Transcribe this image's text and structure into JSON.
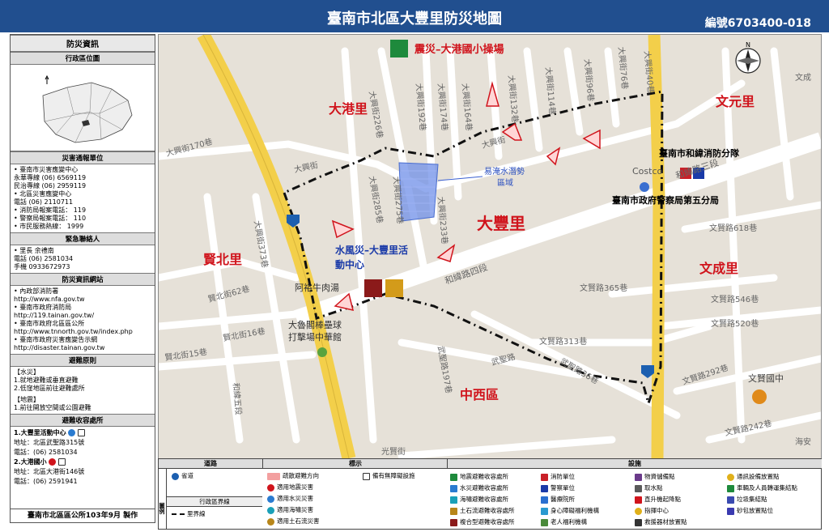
{
  "header": {
    "title": "臺南市北區大豐里防災地圖",
    "code": "編號6703400-018"
  },
  "sidebar": {
    "title": "防災資訊",
    "admin_map": "行政區位圖",
    "report_title": "災害通報單位",
    "report_lines": [
      "• 臺南市災害應變中心",
      "永華專線 (06) 6569119",
      "民治專線 (06) 2959119",
      "• 北區災害應變中心",
      "電話 (06) 2110711",
      "• 消防局報案電話： 119",
      "• 警察局報案電話： 110",
      "• 市民服務熱線： 1999"
    ],
    "contact_title": "緊急聯絡人",
    "contact_lines": [
      "• 里長 余禮南",
      "電話 (06) 2581034",
      "手機 0933672973"
    ],
    "web_title": "防災資訊網站",
    "web_lines": [
      "• 內政部消防署",
      "http://www.nfa.gov.tw",
      "• 臺南市政府消防局",
      "http://119.tainan.gov.tw/",
      "• 臺南市政府北區區公所",
      "http://www.tnnorth.gov.tw/index.php",
      "• 臺南市政府災害應變告示網",
      "http://disaster.tainan.gov.tw"
    ],
    "principle_title": "避難原則",
    "principle_lines": [
      "【水災】",
      "1.就地避難或垂直避難",
      "2.低窪地區前往避難處所",
      "",
      "【地震】",
      "1.前往開放空間或公園避難"
    ],
    "shelter_title": "避難收容處所",
    "shelter_lines": [
      "1.大豐里活動中心",
      "地址：北區武聖路315號",
      "電話：(06) 2581034",
      "2.大港國小",
      "地址：北區大港街146號",
      "電話：(06) 2591941"
    ],
    "footer": "臺南市北區區公所103年9月 製作"
  },
  "map": {
    "districts": [
      "大港里",
      "文元里",
      "大豐里",
      "賢北里",
      "文成里",
      "中西區"
    ],
    "poi": {
      "earthquake_shelter": "震災–大港國小操場",
      "flood_shelter_1": "水風災–大豐里活",
      "flood_shelter_2": "動中心",
      "flood_area_1": "易淹水潛勢",
      "flood_area_2": "區域",
      "fire_brigade": "臺南市和緯消防分隊",
      "police": "臺南市政府警察局第五分局",
      "costco": "Costco",
      "restaurant": "阿裕牛肉湯",
      "batting_1": "大魯閣棒壘球",
      "batting_2": "打擊場中華館"
    },
    "roads": [
      "和緯路四段",
      "和緯路三段",
      "大興街",
      "大興街170巷",
      "大興街226巷",
      "大興街192巷",
      "大興街174巷",
      "大興街164巷",
      "大興街132巷",
      "大興街114巷",
      "大興街96巷",
      "大興街76巷",
      "大興街40巷",
      "大興街285巷",
      "大興街275巷",
      "大興街233巷",
      "大興街373巷",
      "賢北街62巷",
      "賢北街16巷",
      "賢北街15巷",
      "文賢路365巷",
      "文賢路313巷",
      "文賢路618巷",
      "文賢路546巷",
      "文賢路520巷",
      "文賢路292巷",
      "文賢路242巷",
      "武聖路",
      "武聖路36巷",
      "武聖路197巷",
      "光賢街",
      "和緯五段",
      "文賢國中",
      "海安",
      "文成",
      "文賢三段"
    ],
    "road_labels": {
      "r1": "和緯路四段",
      "r2": "大興街170巷",
      "r3": "大興街226巷",
      "r4": "大興街192巷",
      "r5": "大興街174巷",
      "r6": "大興街164巷",
      "r7": "大興街132巷",
      "r8": "大興街114巷",
      "r9": "大興街96巷",
      "r10": "大興街76巷",
      "r11": "大興街40巷",
      "r12": "大興街285巷",
      "r13": "大興街275巷",
      "r14": "大興街233巷",
      "r15": "大興街373巷",
      "r16": "賢北街62巷",
      "r17": "賢北街16巷",
      "r18": "文賢路365巷",
      "r19": "文賢路313巷",
      "r20": "文賢路618巷",
      "r21": "文賢路546巷",
      "r22": "文賢路520巷",
      "r23": "文賢路292巷",
      "r24": "武聖路",
      "r25": "武聖路36巷",
      "r26": "武聖路197巷",
      "r27": "光賢街",
      "r28": "文賢國中",
      "r29": "海安",
      "r30": "文成",
      "r31": "和緯路三段",
      "r32": "文賢路242巷",
      "r33": "和緯五段",
      "r34": "大興街",
      "r35": "賢北街15巷",
      "r36": "大興街"
    }
  },
  "legend": {
    "road_h": "道路",
    "sign_h": "標示",
    "fac_h": "設施",
    "legend_side": "圖例",
    "road_items": [
      "省道",
      "行政區界線",
      "里界線"
    ],
    "sign_items": [
      "疏散避難方向",
      "適用地震災害",
      "適用水災災害",
      "適用海嘯災害",
      "適用土石流災害",
      "備有無障礙設施"
    ],
    "fac_col1": [
      "地震避難收容處所",
      "水災避難收容處所",
      "海嘯避難收容處所",
      "土石流避難收容處所",
      "複合型避難收容處所"
    ],
    "fac_col2": [
      "消防單位",
      "警察單位",
      "醫療院所",
      "身心障礙福利機構",
      "老人福利機構"
    ],
    "fac_col3": [
      "物資儲備點",
      "取水點",
      "直升機起降點",
      "指揮中心",
      "救援器材放置點"
    ],
    "fac_col4": [
      "通訊設備放置點",
      "車輛及人員轉運集結點",
      "垃圾集結點",
      "砂包放置點位",
      ""
    ]
  },
  "colors": {
    "title_bg": "#214f8f",
    "district_red": "#d0141c",
    "shelter_blue": "#1a3aa8",
    "road_yellow": "#f3cf4a",
    "boundary": "#111111"
  }
}
